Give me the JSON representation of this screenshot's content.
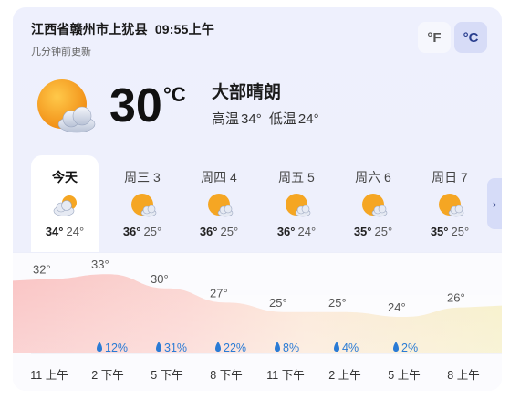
{
  "location": "江西省赣州市上犹县",
  "time": "09:55上午",
  "updated": "几分钟前更新",
  "units": {
    "f": "°F",
    "c": "°C",
    "selected": "c"
  },
  "current": {
    "temp": "30",
    "unit": "°C",
    "condition": "大部晴朗",
    "high_label": "高温",
    "high": "34°",
    "low_label": "低温",
    "low": "24°",
    "icon": "sun-cloud-icon"
  },
  "days": [
    {
      "name": "今天",
      "hi": "34°",
      "lo": "24°",
      "icon": "cloud-sun-icon",
      "active": true
    },
    {
      "name": "周三 3",
      "hi": "36°",
      "lo": "25°",
      "icon": "sun-cloud-icon"
    },
    {
      "name": "周四 4",
      "hi": "36°",
      "lo": "25°",
      "icon": "sun-cloud-icon"
    },
    {
      "name": "周五 5",
      "hi": "36°",
      "lo": "24°",
      "icon": "sun-cloud-icon"
    },
    {
      "name": "周六 6",
      "hi": "35°",
      "lo": "25°",
      "icon": "sun-cloud-icon"
    },
    {
      "name": "周日 7",
      "hi": "35°",
      "lo": "25°",
      "icon": "sun-cloud-icon"
    }
  ],
  "next_icon": "chevron-right-icon",
  "hourly": {
    "temps": [
      "32°",
      "33°",
      "30°",
      "27°",
      "25°",
      "25°",
      "24°",
      "26°"
    ],
    "values": [
      32,
      33,
      30,
      27,
      25,
      25,
      24,
      26
    ],
    "precip": [
      "12%",
      "31%",
      "22%",
      "8%",
      "4%",
      "2%"
    ],
    "times": [
      "11 上午",
      "2 下午",
      "5 下午",
      "8 下午",
      "11 下午",
      "2 上午",
      "5 上午",
      "8 上午"
    ]
  },
  "colors": {
    "accent": "#2a3f8f",
    "rain": "#2a7bd5",
    "warm": "#f7b3b3",
    "mild": "#f8e4b3"
  }
}
